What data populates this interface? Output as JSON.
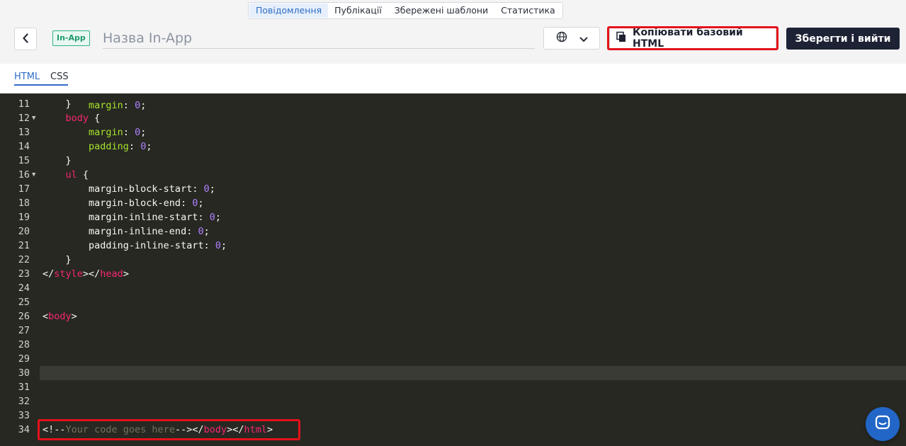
{
  "top_tabs": [
    "Повідомлення",
    "Публікації",
    "Збережені шаблони",
    "Статистика"
  ],
  "active_top_tab": 0,
  "header": {
    "badge": "In-App",
    "name_placeholder": "Назва In-App",
    "copy_button": "Копіювати базовий HTML",
    "save_button": "Зберегти і вийти"
  },
  "editor_tabs": [
    "HTML",
    "CSS"
  ],
  "active_editor_tab": 0,
  "active_line": 30,
  "code_lines": [
    {
      "n": "11",
      "fold": false,
      "html": "    }"
    },
    {
      "n": "12",
      "fold": true,
      "html": "    <span class=\"tag\">body</span> {"
    },
    {
      "n": "13",
      "fold": false,
      "html": "        <span class=\"prop\">margin</span>: <span class=\"num\">0</span>;"
    },
    {
      "n": "14",
      "fold": false,
      "html": "        <span class=\"prop\">padding</span>: <span class=\"num\">0</span>;"
    },
    {
      "n": "15",
      "fold": false,
      "html": "    }"
    },
    {
      "n": "16",
      "fold": true,
      "html": "    <span class=\"tag\">ul</span> {"
    },
    {
      "n": "17",
      "fold": false,
      "html": "        margin-block-start: <span class=\"num\">0</span>;"
    },
    {
      "n": "18",
      "fold": false,
      "html": "        margin-block-end: <span class=\"num\">0</span>;"
    },
    {
      "n": "19",
      "fold": false,
      "html": "        margin-inline-start: <span class=\"num\">0</span>;"
    },
    {
      "n": "20",
      "fold": false,
      "html": "        margin-inline-end: <span class=\"num\">0</span>;"
    },
    {
      "n": "21",
      "fold": false,
      "html": "        padding-inline-start: <span class=\"num\">0</span>;"
    },
    {
      "n": "22",
      "fold": false,
      "html": "    }"
    },
    {
      "n": "23",
      "fold": false,
      "html": "&lt;/<span class=\"tag\">style</span>&gt;&lt;/<span class=\"tag\">head</span>&gt;"
    },
    {
      "n": "24",
      "fold": false,
      "html": ""
    },
    {
      "n": "25",
      "fold": false,
      "html": ""
    },
    {
      "n": "26",
      "fold": false,
      "html": "&lt;<span class=\"tag\">body</span>&gt;"
    },
    {
      "n": "27",
      "fold": false,
      "html": ""
    },
    {
      "n": "28",
      "fold": false,
      "html": ""
    },
    {
      "n": "29",
      "fold": false,
      "html": ""
    },
    {
      "n": "30",
      "fold": false,
      "html": ""
    },
    {
      "n": "31",
      "fold": false,
      "html": ""
    },
    {
      "n": "32",
      "fold": false,
      "html": ""
    },
    {
      "n": "33",
      "fold": false,
      "html": ""
    },
    {
      "n": "34",
      "fold": false,
      "html": "&lt;!--<span class=\"cmt\">Your code goes here</span>--&gt;&lt;/<span class=\"tag\">body</span>&gt;&lt;/<span class=\"tag\">html</span>&gt;"
    }
  ],
  "colors": {
    "accent": "#2f6cc6",
    "annotation_red": "#e3131a",
    "editor_bg": "#272822",
    "save_bg": "#1d2235",
    "chat_bg": "#2266c8"
  },
  "icons": {
    "back": "chevron-left-icon",
    "language": "globe-icon",
    "dropdown": "chevron-down-icon",
    "copy": "copy-icon",
    "chat": "chat-icon"
  }
}
